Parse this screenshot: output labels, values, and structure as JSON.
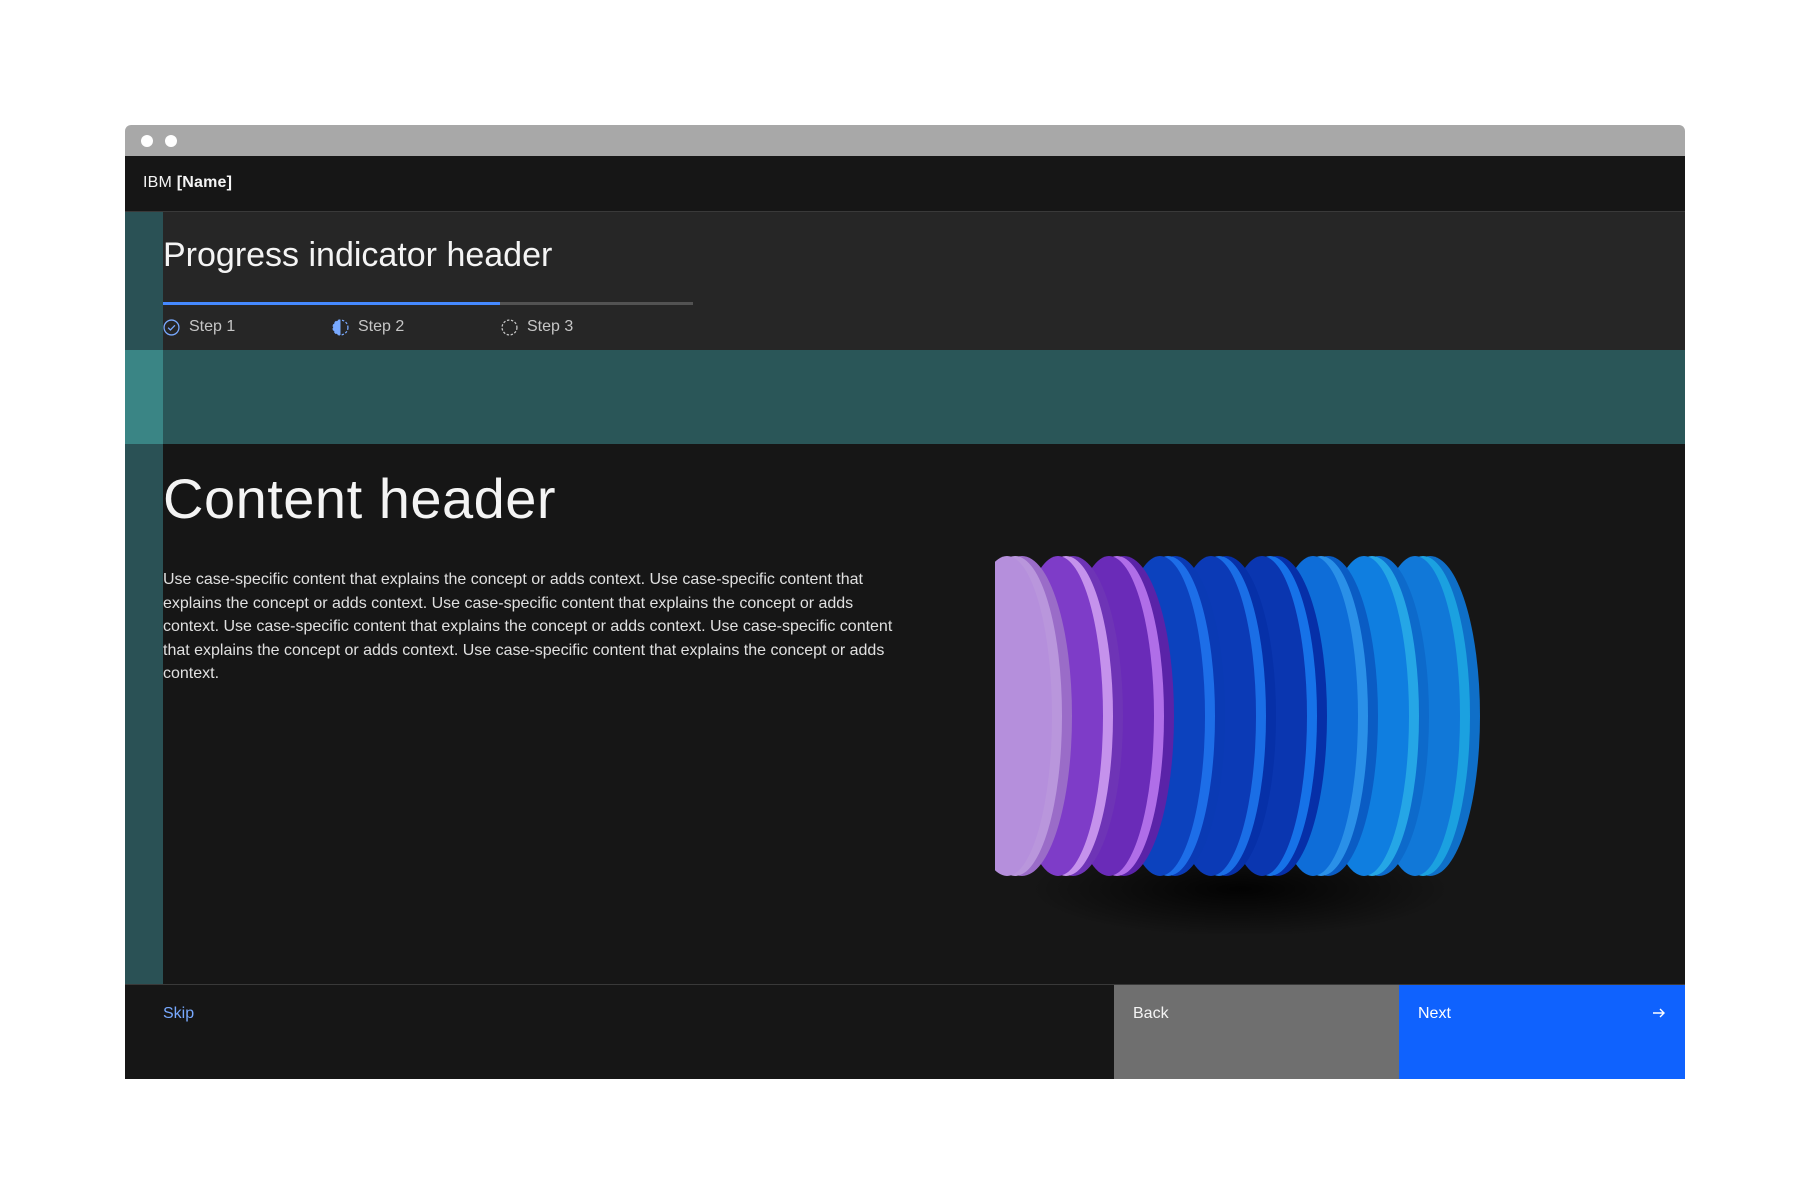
{
  "window": {
    "chrome_dots": 2
  },
  "header": {
    "brand_prefix": "IBM",
    "brand_name": "[Name]"
  },
  "progress": {
    "title": "Progress indicator header",
    "completion": 0.636,
    "steps": [
      {
        "label": "Step 1",
        "state": "complete",
        "icon": "checkmark-outline-icon"
      },
      {
        "label": "Step 2",
        "state": "current",
        "icon": "incomplete-half-icon"
      },
      {
        "label": "Step 3",
        "state": "incomplete",
        "icon": "circle-dash-icon"
      }
    ]
  },
  "content": {
    "title": "Content header",
    "body": "Use case-specific content that explains the concept or adds context. Use case-specific content that explains the concept or adds context. Use case-specific content that explains the concept or adds context. Use case-specific content that explains the concept or adds context. Use case-specific content that explains the concept or adds context. Use case-specific content that explains the concept or adds context.",
    "illustration": "stacked-discs-illustration"
  },
  "footer": {
    "skip_label": "Skip",
    "back_label": "Back",
    "next_label": "Next",
    "next_icon": "arrow-right-icon"
  },
  "colors": {
    "accent": "#0f62fe",
    "progress_fill": "#4589ff",
    "link": "#78a9ff",
    "teal_band": "#2a5658",
    "background": "#161616"
  }
}
